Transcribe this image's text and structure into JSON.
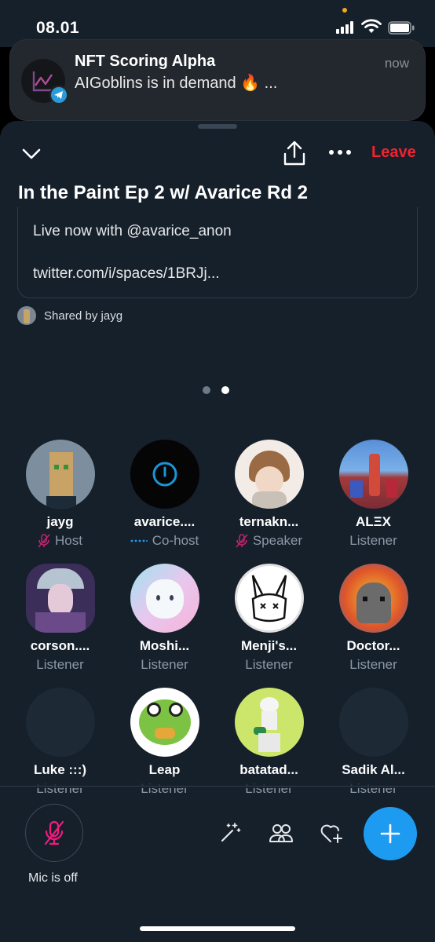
{
  "status_bar": {
    "time": "08.01"
  },
  "notification": {
    "app_title": "NFT Scoring Alpha",
    "body": "AIGoblins is in demand 🔥 ...",
    "time": "now"
  },
  "header": {
    "leave_label": "Leave"
  },
  "space": {
    "title": "In the Paint Ep 2 w/ Avarice Rd 2",
    "tweet_line1": "Live now with @avarice_anon",
    "tweet_line2": "twitter.com/i/spaces/1BRJj...",
    "shared_by": "Shared by jayg"
  },
  "participants": [
    {
      "name": "jayg",
      "role": "Host",
      "muted": true
    },
    {
      "name": "avarice....",
      "role": "Co-host",
      "muted": false
    },
    {
      "name": "ternakn...",
      "role": "Speaker",
      "muted": true
    },
    {
      "name": "ALΞX",
      "role": "Listener",
      "muted": false
    },
    {
      "name": "corson....",
      "role": "Listener",
      "muted": false
    },
    {
      "name": "Moshi...",
      "role": "Listener",
      "muted": false
    },
    {
      "name": "Menji's...",
      "role": "Listener",
      "muted": false
    },
    {
      "name": "Doctor...",
      "role": "Listener",
      "muted": false
    },
    {
      "name": "Luke :::)",
      "role": "Listener",
      "muted": false
    },
    {
      "name": "Leap",
      "role": "Listener",
      "muted": false
    },
    {
      "name": "batatad...",
      "role": "Listener",
      "muted": false
    },
    {
      "name": "Sadik Al...",
      "role": "Listener",
      "muted": false
    }
  ],
  "bottom_bar": {
    "mic_label": "Mic is off"
  },
  "colors": {
    "accent": "#1d9bf0",
    "leave": "#f4212e",
    "mic_off": "#f91880",
    "background": "#15202b"
  }
}
